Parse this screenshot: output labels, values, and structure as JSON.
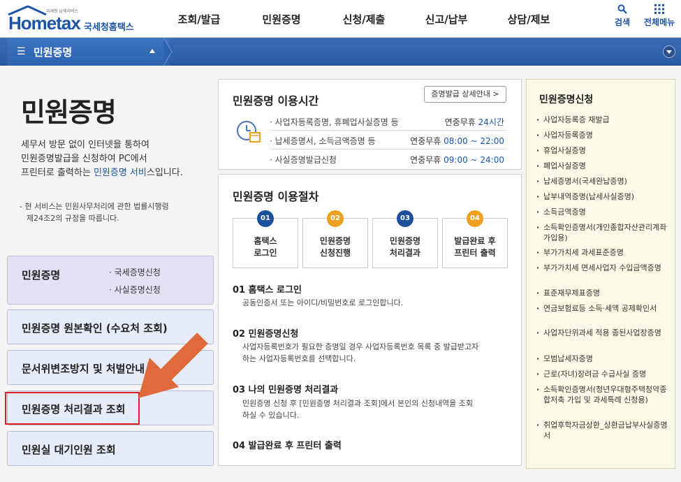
{
  "header": {
    "logo_small": "국세청 납세서비스",
    "logo_word": "Hometax",
    "logo_kor": "국세청홈택스",
    "nav": [
      "조회/발급",
      "민원증명",
      "신청/제출",
      "신고/납부",
      "상담/제보"
    ],
    "search_label": "검색",
    "allmenu_label": "전체메뉴"
  },
  "locbar": {
    "current": "민원증명"
  },
  "intro": {
    "title": "민원증명",
    "desc1": "세무서 방문 없이 인터넷을 통하여",
    "desc2": "민원증명발급을 신청하여 PC에서",
    "desc3_pre": "프린터로 출력하는 ",
    "desc3_hl": "민원증명 서비",
    "desc3_post": "스입니다.",
    "note1": "- 현 서비스는 민원사무처리에 관한 법률시행령",
    "note2": "제24조2의 규정을 따릅니다."
  },
  "left_menu": [
    {
      "title": "민원증명",
      "subs": [
        "국세증명신청",
        "사실증명신청"
      ]
    },
    {
      "title": "민원증명 원본확인 (수요처 조회)"
    },
    {
      "title": "문서위변조방지 및 처벌안내"
    },
    {
      "title": "민원증명 처리결과 조회"
    },
    {
      "title": "민원실 대기인원 조회"
    }
  ],
  "hours": {
    "title": "민원증명 이용시간",
    "detail_btn": "증명발급 상세안내 >",
    "rows": [
      {
        "service": "· 사업자등록증명, 휴폐업사실증명 등",
        "label": "연중무휴 ",
        "value": "24시간"
      },
      {
        "service": "· 납세증명서, 소득금액증명 등",
        "label": "연중무휴 ",
        "value": "08:00 ~ 22:00"
      },
      {
        "service": "· 사실증명발급신청",
        "label": "연중무휴 ",
        "value": "09:00 ~ 24:00"
      }
    ]
  },
  "procedure": {
    "title": "민원증명 이용절차",
    "steps": [
      {
        "num": "01",
        "line1": "홈택스",
        "line2": "로그인"
      },
      {
        "num": "02",
        "line1": "민원증명",
        "line2": "신청진행"
      },
      {
        "num": "03",
        "line1": "민원증명",
        "line2": "처리결과"
      },
      {
        "num": "04",
        "line1": "발급완료 후",
        "line2": "프린터 출력"
      }
    ],
    "items": [
      {
        "title": "01 홈택스 로그인",
        "desc1": "공동인증서 또는 아이디/비밀번호로 로그인합니다.",
        "desc2": ""
      },
      {
        "title": "02 민원증명신청",
        "desc1": "사업자등록번호가 필요한 증명일 경우 사업자등록번호 목록 중 발급받고자",
        "desc2": "하는 사업자등록번호를 선택합니다."
      },
      {
        "title": "03 나의 민원증명 처리결과",
        "desc1": "민원증명 신청 후 [민원증명 처리결과 조회]에서 본인의 신청내역을 조회",
        "desc2": "하실 수 있습니다."
      },
      {
        "title": "04 발급완료 후 프린터 출력",
        "desc1": "",
        "desc2": ""
      }
    ]
  },
  "right": {
    "title": "민원증명신청",
    "items": [
      "사업자등록증 재발급",
      "사업자등록증명",
      "휴업사실증명",
      "폐업사실증명",
      "납세증명서(국세완납증명)",
      "납부내역증명(납세사실증명)",
      "소득금액증명",
      "소득확인증명서(개인종합자산관리계좌 가입용)",
      "부가가치세 과세표준증명",
      "부가가치세 면세사업자 수입금액증명",
      "표준재무제표증명",
      "연금보험료등 소득·세액 공제확인서",
      "사업자단위과세 적용 종된사업장증명",
      "모범납세자증명",
      "근로(자녀)장려금 수급사실 증명",
      "소득확인증명서(청년우대형주택청약종합저축 가입 및 과세특례 신청용)",
      "취업후학자금상환_상환금납부사실증명서"
    ]
  },
  "colors": {
    "brand_blue": "#1c54a7",
    "highlight_red": "#e02020",
    "arrow_orange": "#e06a3c",
    "step_orange": "#f0a020"
  }
}
